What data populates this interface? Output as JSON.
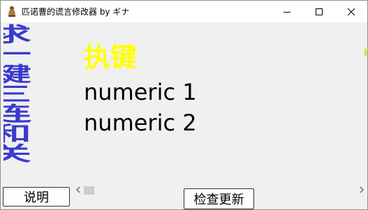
{
  "window": {
    "title": "匹诺曹的谎言修改器 by ギナ",
    "app_icon": "puppet-icon",
    "caption_buttons": [
      "minimize-icon",
      "maximize-icon",
      "close-icon"
    ]
  },
  "sidebar": {
    "text": "求一键三连和关注",
    "color": "#3a3acc"
  },
  "main": {
    "hotkey_title": "执键",
    "hotkey_color": "#ffff00",
    "lines": [
      "numeric 1",
      "numeric 2"
    ]
  },
  "scrollbar": {
    "left_arrow": "chevron-left-icon",
    "right_arrow": "chevron-right-icon"
  },
  "buttons": {
    "explain_label": "说明",
    "update_label": "检查更新"
  }
}
